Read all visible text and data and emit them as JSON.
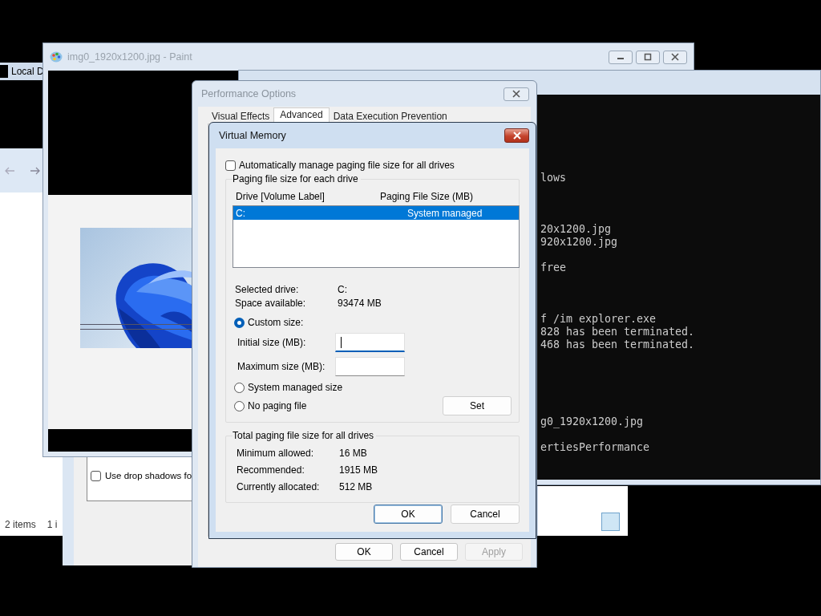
{
  "explorer": {
    "title": "Local D",
    "status_items": [
      "2 items",
      "1 i"
    ]
  },
  "back_window": {
    "checkbox": {
      "label": "Use drop shadows fo",
      "checked": false
    }
  },
  "paint": {
    "title": "img0_1920x1200.jpg - Paint"
  },
  "terminal": {
    "output_blocks": [
      [
        "lows"
      ],
      [
        "20x1200.jpg",
        "920x1200.jpg"
      ],
      [
        "free"
      ],
      [
        "f /im explorer.exe",
        "828 has been terminated.",
        "468 has been terminated."
      ],
      [
        "g0_1920x1200.jpg"
      ],
      [
        "ertiesPerformance"
      ]
    ]
  },
  "performance_options": {
    "title": "Performance Options",
    "tabs": [
      {
        "label": "Visual Effects",
        "selected": false
      },
      {
        "label": "Advanced",
        "selected": true
      },
      {
        "label": "Data Execution Prevention",
        "selected": false
      }
    ],
    "buttons": [
      {
        "label": "OK",
        "disabled": false
      },
      {
        "label": "Cancel",
        "disabled": false
      },
      {
        "label": "Apply",
        "disabled": true
      }
    ]
  },
  "virtual_memory": {
    "title": "Virtual Memory",
    "auto_manage": {
      "label": "Automatically manage paging file size for all drives",
      "checked": false
    },
    "drives_group": {
      "title": "Paging file size for each drive",
      "columns": [
        "Drive  [Volume Label]",
        "Paging File Size (MB)"
      ],
      "rows": [
        {
          "drive": "C:",
          "size": "System managed",
          "selected": true
        }
      ],
      "info": [
        {
          "label": "Selected drive:",
          "value": "C:"
        },
        {
          "label": "Space available:",
          "value": "93474 MB"
        }
      ],
      "options": [
        {
          "label": "Custom size:",
          "selected": true
        },
        {
          "label": "System managed size",
          "selected": false
        },
        {
          "label": "No paging file",
          "selected": false
        }
      ],
      "fields": [
        {
          "label": "Initial size (MB):",
          "focused": true
        },
        {
          "label": "Maximum size (MB):",
          "focused": false
        }
      ],
      "set_button": "Set"
    },
    "totals_group": {
      "title": "Total paging file size for all drives",
      "rows": [
        {
          "label": "Minimum allowed:",
          "value": "16 MB"
        },
        {
          "label": "Recommended:",
          "value": "1915 MB"
        },
        {
          "label": "Currently allocated:",
          "value": "512 MB"
        }
      ]
    },
    "buttons": [
      {
        "label": "OK",
        "default": true
      },
      {
        "label": "Cancel",
        "default": false
      }
    ]
  }
}
